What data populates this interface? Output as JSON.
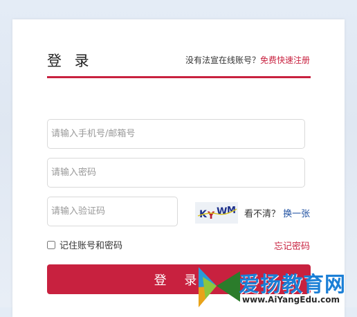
{
  "header": {
    "title": "登 录",
    "register_prompt": "没有法宣在线账号？",
    "register_link": "免费快速注册"
  },
  "form": {
    "account_placeholder": "请输入手机号/邮箱号",
    "password_placeholder": "请输入密码",
    "captcha_placeholder": "请输入验证码",
    "captcha_text": "KYWM",
    "unclear_label": "看不清？",
    "refresh_label": "换一张",
    "remember_label": "记住账号和密码",
    "forgot_label": "忘记密码",
    "submit_label": "登 录"
  },
  "watermark": {
    "brand": "爱扬教育网",
    "url": "www.AiYangEdu.com"
  },
  "colors": {
    "accent": "#c8213f",
    "link_blue": "#1e4fa0"
  }
}
